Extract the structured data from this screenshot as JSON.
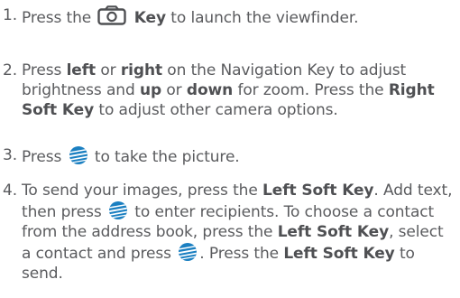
{
  "steps": [
    {
      "number": "1.",
      "parts": {
        "a": "Press the",
        "key": "Key",
        "b": "to launch the viewfinder."
      }
    },
    {
      "number": "2.",
      "parts": {
        "a": "Press",
        "left": "left",
        "or1": "or",
        "right": "right",
        "b": "on the Navigation Key to adjust brightness and",
        "up": "up",
        "or2": "or",
        "down": "down",
        "c": "for zoom. Press the",
        "rsk": "Right Soft Key",
        "d": "to adjust other camera options."
      }
    },
    {
      "number": "3.",
      "parts": {
        "a": "Press",
        "b": "to take the picture."
      }
    },
    {
      "number": "4.",
      "parts": {
        "a": "To send your images, press the",
        "lsk1": "Left Soft Key",
        "p1": ".",
        "b": "Add text, then press",
        "c": "to enter recipients. To choose a contact from the address book, press the",
        "lsk2": "Left Soft Key",
        "d": ", select a contact and press",
        "e": ". Press the",
        "lsk3": "Left Soft Key",
        "f": "to send."
      }
    }
  ],
  "icons": {
    "camera_key": "camera-key-icon",
    "ok_key": "att-globe-icon"
  },
  "colors": {
    "text": "#5a5b5e",
    "globe": "#1a7fc1"
  }
}
